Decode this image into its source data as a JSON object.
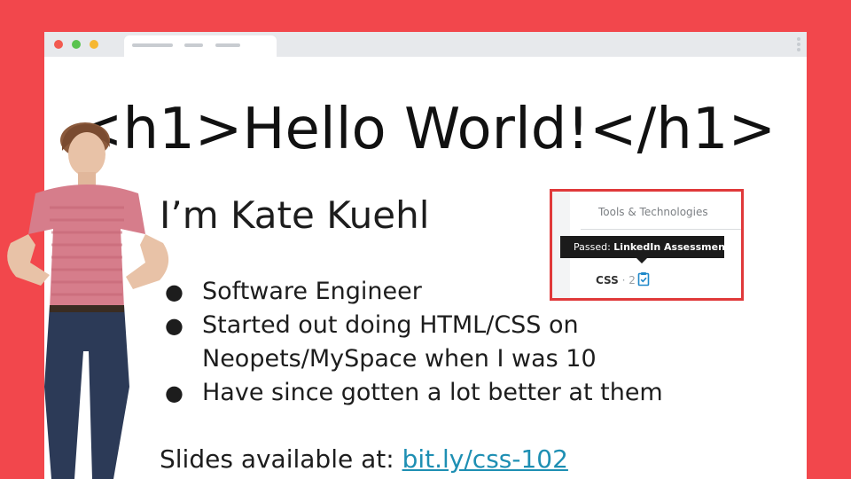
{
  "browser": {
    "window_dots": [
      "red",
      "green",
      "yellow"
    ],
    "colors": {
      "background": "#f2474c",
      "link": "#1e8fb3",
      "highlight_border": "#e0393a"
    }
  },
  "slide": {
    "heading": "<h1>Hello World!</h1>",
    "name": "I’m Kate Kuehl",
    "bullets": [
      {
        "line1": "Software Engineer"
      },
      {
        "line1": "Started out doing HTML/CSS on",
        "line2": "Neopets/MySpace when I was 10"
      },
      {
        "line1": "Have since gotten a lot better at them"
      }
    ],
    "bullet_glyph": "●",
    "slides_label": "Slides available at: ",
    "slides_link": "bit.ly/css-102"
  },
  "inset": {
    "section_title": "Tools & Technologies",
    "tooltip_prefix": "Passed: ",
    "tooltip_bold": "LinkedIn Assessments",
    "skill_name": "CSS",
    "skill_sep": " · ",
    "skill_count": "2",
    "badge_icon": "clipboard-check-icon"
  }
}
